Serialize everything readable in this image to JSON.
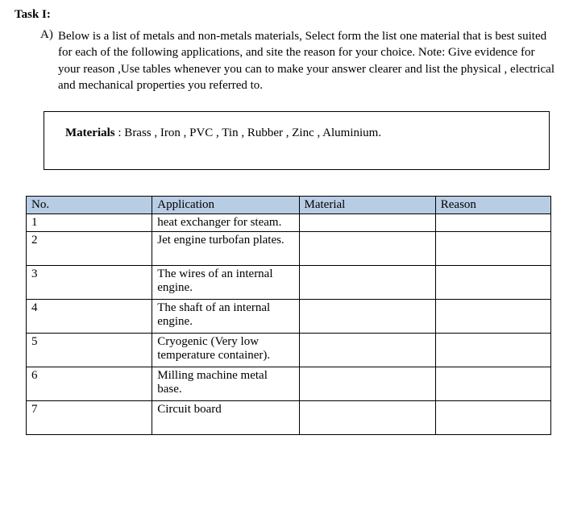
{
  "task_label": "Task I:",
  "section_a": {
    "letter": "A)",
    "text": "Below is a list of metals and non-metals materials, Select form the list one material that is best suited for each of the following applications, and site the reason for your choice.  Note:  Give evidence for your  reason ,Use tables  whenever you can  to make your answer clearer and list the physical , electrical and mechanical properties you referred to."
  },
  "materials_box": {
    "label": "Materials",
    "list_text": " :  Brass  ,      Iron    ,      PVC     ,    Tin  ,      Rubber  ,       Zinc    ,  Aluminium."
  },
  "table": {
    "headers": {
      "no": "No.",
      "application": "Application",
      "material": "Material",
      "reason": "Reason"
    },
    "rows": [
      {
        "no": "1",
        "application": "heat exchanger for steam.",
        "material": "",
        "reason": ""
      },
      {
        "no": "2",
        "application": "Jet engine turbofan plates.",
        "material": "",
        "reason": ""
      },
      {
        "no": "3",
        "application": "The wires of an internal engine.",
        "material": "",
        "reason": ""
      },
      {
        "no": "4",
        "application": "The shaft of an internal engine.",
        "material": "",
        "reason": ""
      },
      {
        "no": "5",
        "application": "Cryogenic (Very low temperature container).",
        "material": "",
        "reason": ""
      },
      {
        "no": "6",
        "application": "Milling machine metal base.",
        "material": "",
        "reason": ""
      },
      {
        "no": "7",
        "application": "Circuit board",
        "material": "",
        "reason": ""
      }
    ]
  }
}
